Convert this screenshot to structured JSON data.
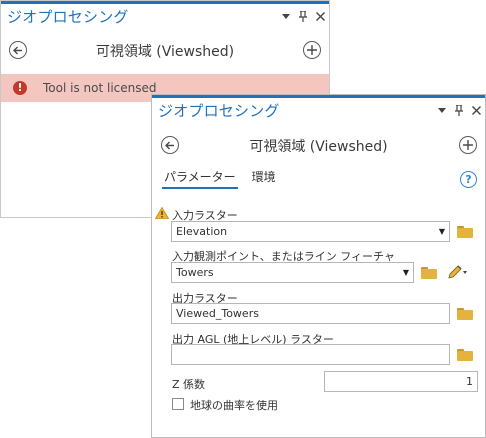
{
  "colors": {
    "accent": "#1e73be",
    "title_text": "#1e73be",
    "error_bg": "#f4c6c0",
    "error_icon": "#c4382b",
    "folder": "#e4b33d",
    "folder_dark": "#c9962a",
    "warning": "#f0b429",
    "help": "#2f86d8"
  },
  "back_pane": {
    "title": "ジオプロセシング",
    "tool_title": "可視領域 (Viewshed)",
    "error_message": "Tool is not licensed"
  },
  "front_pane": {
    "title": "ジオプロセシング",
    "tool_title": "可視領域 (Viewshed)",
    "tabs": [
      {
        "label": "パラメーター",
        "active": true
      },
      {
        "label": "環境",
        "active": false
      }
    ],
    "help_glyph": "?",
    "params": {
      "input_raster": {
        "label": "入力ラスター",
        "value": "Elevation"
      },
      "observer": {
        "label": "入力観測ポイント、またはライン フィーチャ",
        "value": "Towers"
      },
      "output_raster": {
        "label": "出力ラスター",
        "value": "Viewed_Towers"
      },
      "output_agl": {
        "label": "出力 AGL (地上レベル) ラスター",
        "value": ""
      },
      "z_factor": {
        "label": "Z 係数",
        "value": "1"
      },
      "curvature": {
        "label": "地球の曲率を使用",
        "checked": false
      }
    }
  }
}
